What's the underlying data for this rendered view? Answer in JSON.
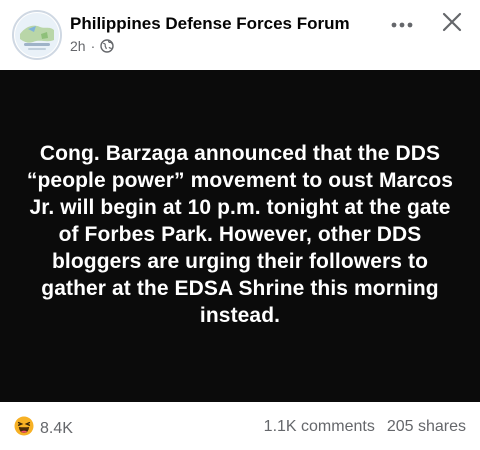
{
  "post": {
    "page_name": "Philippines Defense Forces Forum",
    "time": "2h",
    "separator": "·",
    "body_text": "Cong. Barzaga announced that the DDS “people power” movement to oust Marcos Jr. will begin at 10 p.m. tonight at the gate of Forbes Park. However, other DDS bloggers are urging their followers to gather at the EDSA Shrine this morning instead."
  },
  "footer": {
    "reaction_count": "8.4K",
    "comments": "1.1K comments",
    "shares": "205 shares"
  },
  "icons": {
    "audience": "globe-icon",
    "more": "more-options-icon",
    "close": "close-icon",
    "reaction": "haha-emoji-icon"
  },
  "colors": {
    "image_background": "#0b0b0b",
    "post_text": "#ffffff",
    "meta_gray": "#65676b",
    "reaction_yellow": "#f7b125"
  }
}
